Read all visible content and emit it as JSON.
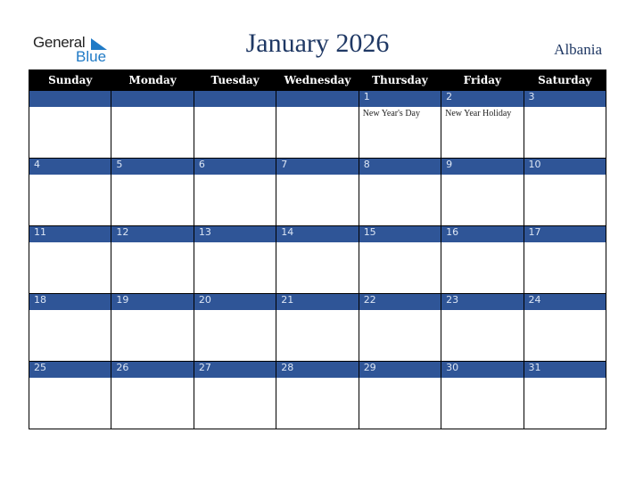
{
  "logo": {
    "line1": "General",
    "line2": "Blue"
  },
  "title": "January 2026",
  "country": "Albania",
  "weekdays": [
    "Sunday",
    "Monday",
    "Tuesday",
    "Wednesday",
    "Thursday",
    "Friday",
    "Saturday"
  ],
  "weeks": [
    {
      "days": [
        "",
        "",
        "",
        "",
        "1",
        "2",
        "3"
      ],
      "events": [
        "",
        "",
        "",
        "",
        "New Year's Day",
        "New Year Holiday",
        ""
      ]
    },
    {
      "days": [
        "4",
        "5",
        "6",
        "7",
        "8",
        "9",
        "10"
      ],
      "events": [
        "",
        "",
        "",
        "",
        "",
        "",
        ""
      ]
    },
    {
      "days": [
        "11",
        "12",
        "13",
        "14",
        "15",
        "16",
        "17"
      ],
      "events": [
        "",
        "",
        "",
        "",
        "",
        "",
        ""
      ]
    },
    {
      "days": [
        "18",
        "19",
        "20",
        "21",
        "22",
        "23",
        "24"
      ],
      "events": [
        "",
        "",
        "",
        "",
        "",
        "",
        ""
      ]
    },
    {
      "days": [
        "25",
        "26",
        "27",
        "28",
        "29",
        "30",
        "31"
      ],
      "events": [
        "",
        "",
        "",
        "",
        "",
        "",
        ""
      ]
    }
  ],
  "colors": {
    "header_bg": "#000000",
    "week_bar": "#2f5597",
    "title": "#1f3864",
    "logo_blue": "#1f7ac6"
  }
}
